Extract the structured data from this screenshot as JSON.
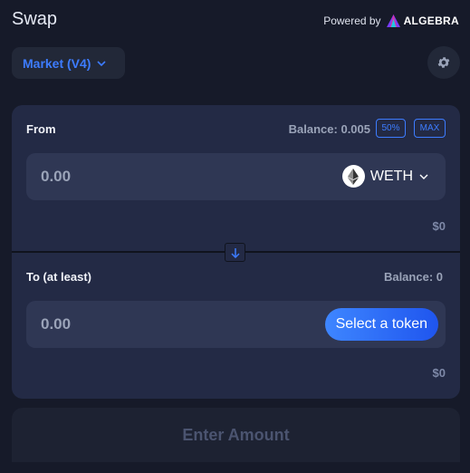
{
  "header": {
    "title": "Swap",
    "powered_by": "Powered by",
    "brand": "ALGEBRA"
  },
  "market": {
    "label": "Market (V4)"
  },
  "from": {
    "label": "From",
    "balance": "Balance: 0.005",
    "pill_50": "50%",
    "pill_max": "MAX",
    "amount_placeholder": "0.00",
    "token": "WETH",
    "usd": "$0"
  },
  "to": {
    "label": "To (at least)",
    "balance": "Balance: 0",
    "amount_placeholder": "0.00",
    "select_token": "Select a token",
    "usd": "$0"
  },
  "action": {
    "label": "Enter Amount"
  },
  "colors": {
    "accent": "#3d7cff",
    "background": "#161a29",
    "card": "#232a45"
  }
}
